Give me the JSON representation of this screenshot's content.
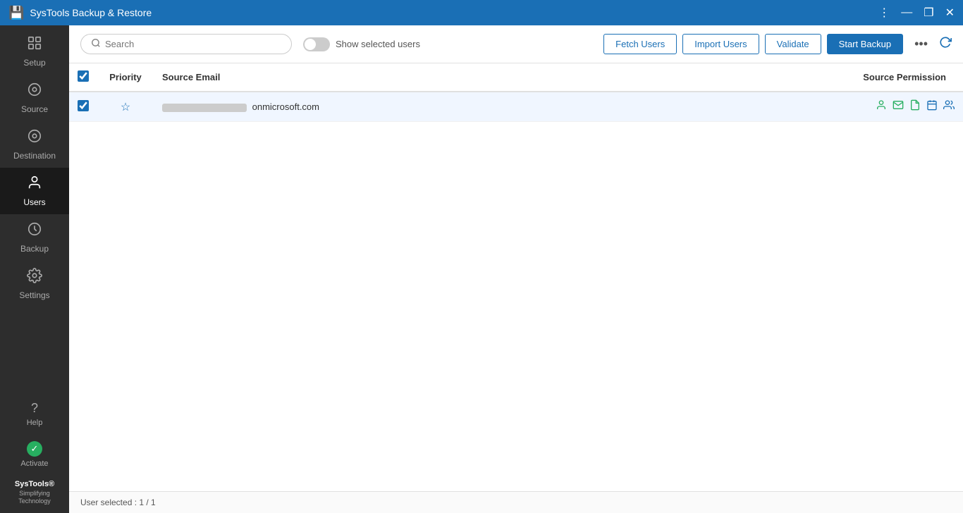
{
  "titleBar": {
    "title": "SysTools Backup & Restore",
    "controls": {
      "menu": "⋮",
      "minimize": "—",
      "restore": "❐",
      "close": "✕"
    }
  },
  "sidebar": {
    "items": [
      {
        "id": "setup",
        "label": "Setup",
        "icon": "⬡"
      },
      {
        "id": "source",
        "label": "Source",
        "icon": "⊙"
      },
      {
        "id": "destination",
        "label": "Destination",
        "icon": "⊙"
      },
      {
        "id": "users",
        "label": "Users",
        "icon": "👤",
        "active": true
      },
      {
        "id": "backup",
        "label": "Backup",
        "icon": "⏱"
      },
      {
        "id": "settings",
        "label": "Settings",
        "icon": "⚙"
      }
    ],
    "bottom": {
      "help_label": "Help",
      "activate_label": "Activate"
    },
    "logo": "SysTools®",
    "logo_sub": "Simplifying Technology"
  },
  "toolbar": {
    "search_placeholder": "Search",
    "toggle_label": "Show selected users",
    "fetch_users": "Fetch Users",
    "import_users": "Import Users",
    "validate": "Validate",
    "start_backup": "Start Backup"
  },
  "table": {
    "headers": {
      "priority": "Priority",
      "source_email": "Source Email",
      "source_permission": "Source Permission"
    },
    "rows": [
      {
        "checked": true,
        "priority_star": "★",
        "email_blurred": true,
        "email_domain": "onmicrosoft.com",
        "permissions": [
          "user",
          "mail",
          "doc",
          "calendar",
          "contacts"
        ]
      }
    ]
  },
  "statusBar": {
    "text": "User selected : 1 / 1"
  }
}
